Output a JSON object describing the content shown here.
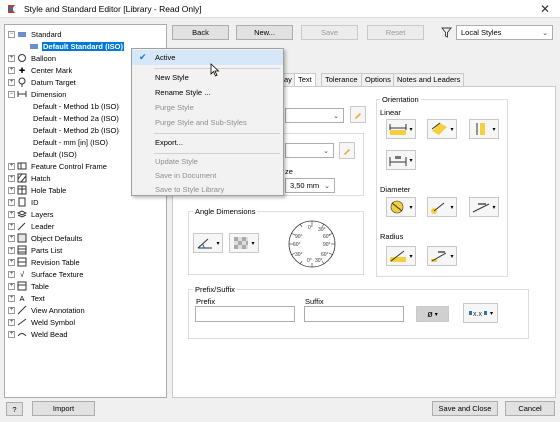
{
  "window": {
    "title": "Style and Standard Editor [Library - Read Only]"
  },
  "toolbar": {
    "back": "Back",
    "new": "New...",
    "save": "Save",
    "reset": "Reset",
    "filter_value": "Local Styles"
  },
  "tree": {
    "root": "Standard",
    "selected": "Default Standard (ISO)",
    "items": [
      "Balloon",
      "Center Mark",
      "Datum Target",
      "Dimension"
    ],
    "dimension_children": [
      "Default - Method 1b (ISO)",
      "Default - Method 2a (ISO)",
      "Default - Method 2b (ISO)",
      "Default - mm [in] (ISO)",
      "Default (ISO)"
    ],
    "more_items": [
      "Feature Control Frame",
      "Hatch",
      "Hole Table",
      "ID",
      "Layers",
      "Leader",
      "Object Defaults",
      "Parts List",
      "Revision Table",
      "Surface Texture",
      "Table",
      "Text",
      "View Annotation",
      "Weld Symbol",
      "Weld Bead"
    ]
  },
  "context_menu": {
    "items": [
      {
        "label": "Active",
        "state": "checked"
      },
      {
        "label": "New Style",
        "state": "enabled"
      },
      {
        "label": "Rename Style ...",
        "state": "enabled"
      },
      {
        "label": "Purge Style",
        "state": "disabled"
      },
      {
        "label": "Purge Style and Sub-Styles",
        "state": "disabled"
      },
      {
        "label": "Export...",
        "state": "enabled"
      },
      {
        "label": "Update Style",
        "state": "disabled"
      },
      {
        "label": "Save in Document",
        "state": "disabled"
      },
      {
        "label": "Save to Style Library",
        "state": "disabled"
      }
    ]
  },
  "tabs": {
    "ay": "ay",
    "text": "Text",
    "tolerance": "Tolerance",
    "options": "Options",
    "notes": "Notes and Leaders"
  },
  "text_panel": {
    "size_frag": "ze",
    "size_value": "3,50 mm"
  },
  "orientation": {
    "title": "Orientation",
    "linear": "Linear",
    "diameter": "Diameter",
    "radius": "Radius"
  },
  "angle": {
    "title": "Angle Dimensions",
    "dial_labels": [
      "0°",
      "30°",
      "60°",
      "90°",
      "60°",
      "30°",
      "0°",
      "30°",
      "60°",
      "90°"
    ]
  },
  "prefix_suffix": {
    "title": "Prefix/Suffix",
    "prefix": "Prefix",
    "suffix": "Suffix",
    "symbol": "ø"
  },
  "footer": {
    "help": "?",
    "import": "Import",
    "save_close": "Save and Close",
    "cancel": "Cancel"
  }
}
